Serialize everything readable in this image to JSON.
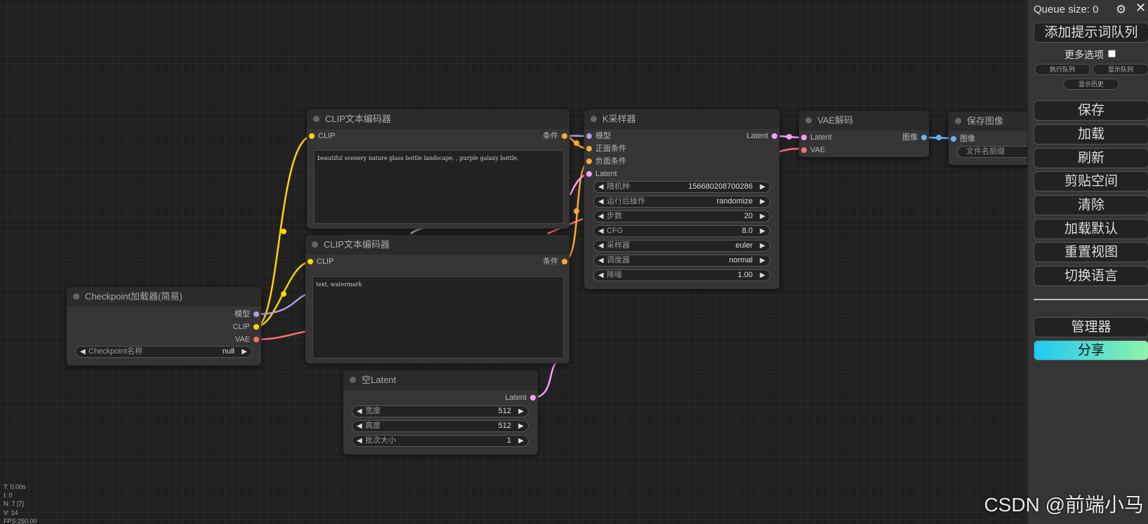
{
  "colors": {
    "clip": "#ffd500",
    "model": "#b39ddb",
    "vae": "#ff6e6e",
    "conditioning": "#ffa931",
    "latent": "#ff9cf9",
    "image": "#64b5f6",
    "share_gradient_start": "#1ec8f5",
    "share_gradient_end": "#8ff3a8"
  },
  "nodes": {
    "clip_pos": {
      "title": "CLIP文本编码器",
      "in_clip": "CLIP",
      "out_cond": "条件",
      "text": "beautiful scenery nature glass bottle landscape, , purple galaxy bottle,"
    },
    "clip_neg": {
      "title": "CLIP文本编码器",
      "in_clip": "CLIP",
      "out_cond": "条件",
      "text": "text, watermark"
    },
    "checkpoint": {
      "title": "Checkpoint加载器(简易)",
      "out_model": "模型",
      "out_clip": "CLIP",
      "out_vae": "VAE",
      "w_name_label": "Checkpoint名称",
      "w_name_value": "null"
    },
    "ksampler": {
      "title": "K采样器",
      "in_model": "模型",
      "in_pos": "正面条件",
      "in_neg": "负面条件",
      "in_latent": "Latent",
      "out_latent": "Latent",
      "widgets": [
        {
          "label": "随机种",
          "value": "156680208700286"
        },
        {
          "label": "运行后操作",
          "value": "randomize"
        },
        {
          "label": "步数",
          "value": "20"
        },
        {
          "label": "CFG",
          "value": "8.0"
        },
        {
          "label": "采样器",
          "value": "euler"
        },
        {
          "label": "调度器",
          "value": "normal"
        },
        {
          "label": "降噪",
          "value": "1.00"
        }
      ]
    },
    "empty_latent": {
      "title": "空Latent",
      "out_latent": "Latent",
      "widgets": [
        {
          "label": "宽度",
          "value": "512"
        },
        {
          "label": "高度",
          "value": "512"
        },
        {
          "label": "批次大小",
          "value": "1"
        }
      ]
    },
    "vae_decode": {
      "title": "VAE解码",
      "in_latent": "Latent",
      "in_vae": "VAE",
      "out_image": "图像"
    },
    "save_image": {
      "title": "保存图像",
      "in_image": "图像",
      "w_prefix": "文件名前缀"
    }
  },
  "menu": {
    "queue_size": "Queue size: 0",
    "gear_icon": "gear-icon",
    "close_icon": "close-icon",
    "queue_prompt": "添加提示词队列",
    "more_options": "更多选项",
    "exec_queue": "执行队列",
    "view_queue": "显示队列",
    "view_history": "显示历史",
    "save": "保存",
    "load": "加载",
    "refresh": "刷新",
    "clipspace": "剪贴空间",
    "clear": "清除",
    "load_default": "加载默认",
    "reset_view": "重置视图",
    "switch_locale": "切换语言",
    "manager": "管理器",
    "share": "分享"
  },
  "stats": {
    "t": "T: 0.00s",
    "i": "I: 0",
    "n": "N: 7 [7]",
    "v": "V: 14",
    "fps": "FPS:250.00"
  },
  "watermark": "CSDN @前端小马"
}
